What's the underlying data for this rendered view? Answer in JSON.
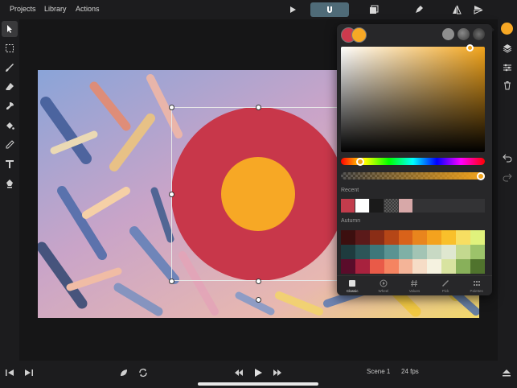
{
  "topbar": {
    "menus": [
      "Projects",
      "Library",
      "Actions"
    ],
    "icons": [
      "play-icon",
      "magnet-icon",
      "onion-skin-icon",
      "pen-nib-icon",
      "flip-horizontal-icon",
      "flip-vertical-icon"
    ]
  },
  "toolbar": {
    "tools": [
      "select-arrow-icon",
      "marquee-select-icon",
      "brush-icon",
      "eraser-icon",
      "smudge-icon",
      "fill-bucket-icon",
      "eyedropper-icon",
      "text-tool-icon",
      "pen-tool-icon"
    ],
    "active_tool": "select-arrow-icon"
  },
  "canvas": {
    "shape_outer_color": "#c8374a",
    "shape_inner_color": "#f7a825"
  },
  "color_panel": {
    "current_color": "#f7a825",
    "previous_color": "#cc3a4d",
    "style_dots": [
      "#8e8e8e",
      "#6a6a6a",
      "#4a4a4a"
    ],
    "hue_color": "#f2a41b",
    "recent_label": "Recent",
    "recent_colors": [
      "#c23c4c",
      "#ffffff",
      "#1a1a1a",
      "checkered",
      "#d7a8a8"
    ],
    "palette_label": "Autumn",
    "palette": [
      [
        "#3c0f0f",
        "#5b1a1a",
        "#8a2d16",
        "#b54617",
        "#d9621a",
        "#e9851d",
        "#f4a21e",
        "#f9c02b",
        "#f7de62",
        "#e0f27c"
      ],
      [
        "#1e3b3e",
        "#2c5558",
        "#3e777a",
        "#5a9392",
        "#7fb0a6",
        "#a3c4b4",
        "#c8d9c4",
        "#dfe7d0",
        "#c3d98f",
        "#9cc36a"
      ],
      [
        "#5a0c2a",
        "#a8223e",
        "#e95a48",
        "#f58461",
        "#f4b498",
        "#f6dcc6",
        "#f5f2e0",
        "#d8e3a0",
        "#88b05a",
        "#50732d"
      ]
    ],
    "tabs": [
      {
        "label": "Classic",
        "icon": "square-icon"
      },
      {
        "label": "Wheel",
        "icon": "wheel-icon"
      },
      {
        "label": "Values",
        "icon": "hash-icon"
      },
      {
        "label": "Pick",
        "icon": "eyedropper-icon"
      },
      {
        "label": "Palettes",
        "icon": "grid-icon"
      }
    ],
    "active_tab": "Classic"
  },
  "rightbar": {
    "icons": [
      "layers-icon",
      "sliders-icon",
      "trash-icon",
      "undo-icon",
      "redo-icon"
    ]
  },
  "bottombar": {
    "scene": "Scene 1",
    "fps": "24 fps",
    "icons": [
      "prev-frame-icon",
      "next-frame-icon",
      "onion-icon",
      "loop-icon",
      "rewind-icon",
      "play-icon",
      "fast-forward-icon",
      "timeline-toggle-icon"
    ]
  }
}
